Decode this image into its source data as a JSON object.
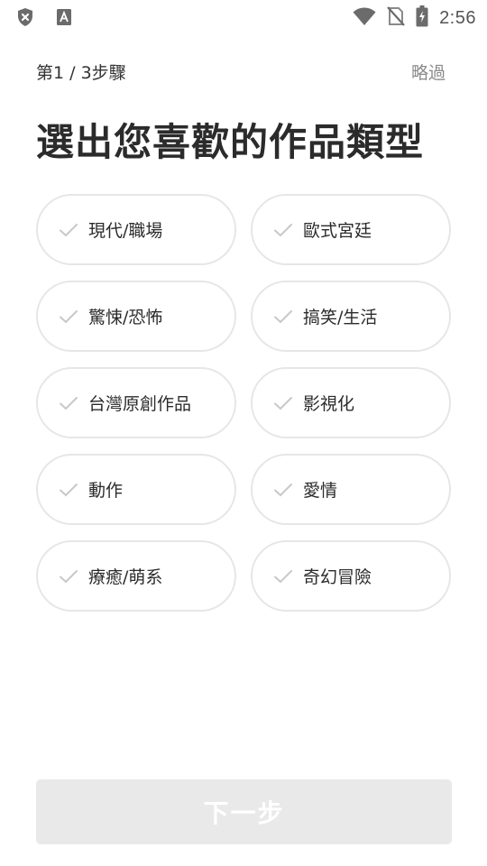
{
  "status_bar": {
    "time": "2:56",
    "icons": [
      "shield-x-icon",
      "font-a-icon",
      "wifi-icon",
      "no-sim-icon",
      "battery-charging-icon"
    ]
  },
  "header": {
    "step": "第1 / 3步驟",
    "skip": "略過",
    "title": "選出您喜歡的作品類型"
  },
  "genres": [
    {
      "label": "現代/職場",
      "selected": false
    },
    {
      "label": "歐式宮廷",
      "selected": false
    },
    {
      "label": "驚悚/恐怖",
      "selected": false
    },
    {
      "label": "搞笑/生活",
      "selected": false
    },
    {
      "label": "台灣原創作品",
      "selected": false
    },
    {
      "label": "影視化",
      "selected": false
    },
    {
      "label": "動作",
      "selected": false
    },
    {
      "label": "愛情",
      "selected": false
    },
    {
      "label": "療癒/萌系",
      "selected": false
    },
    {
      "label": "奇幻冒險",
      "selected": false
    }
  ],
  "next_button": {
    "label": "下一步",
    "enabled": false
  },
  "colors": {
    "option_border": "#e6e6e6",
    "check_gray": "#c8c8c8",
    "button_disabled": "#e9e9e9",
    "skip_text": "#8a8a8a"
  }
}
